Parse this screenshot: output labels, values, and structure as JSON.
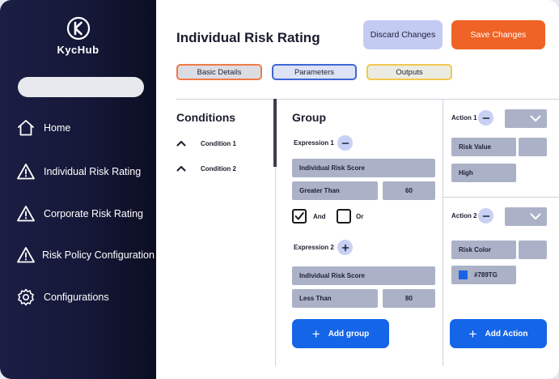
{
  "brand": {
    "logo_text": "KycHub"
  },
  "sidebar": {
    "search_value": "",
    "items": [
      {
        "label": "Home",
        "icon": "home-icon"
      },
      {
        "label": "Individual Risk Rating",
        "icon": "warning-icon"
      },
      {
        "label": "Corporate Risk Rating",
        "icon": "warning-icon"
      },
      {
        "label": "Risk Policy Configuration",
        "icon": "warning-icon"
      },
      {
        "label": "Configurations",
        "icon": "gear-icon"
      }
    ]
  },
  "header": {
    "title": "Individual Risk Rating",
    "discard_label": "Discard Changes",
    "save_label": "Save Changes"
  },
  "tabs": [
    {
      "label": "Basic Details",
      "border_color": "#f07a48"
    },
    {
      "label": "Parameters",
      "border_color": "#3e66d6"
    },
    {
      "label": "Outputs",
      "border_color": "#f0c94c"
    }
  ],
  "conditions": {
    "title": "Conditions",
    "items": [
      {
        "label": "Condition 1"
      },
      {
        "label": "Condition 2"
      }
    ]
  },
  "group": {
    "title": "Group",
    "expression1": {
      "label": "Expression 1",
      "parameter": "Individual Risk Score",
      "operator": "Greater Than",
      "value": "60"
    },
    "logic": {
      "and_label": "And",
      "and_checked": true,
      "or_label": "Or",
      "or_checked": false
    },
    "expression2": {
      "label": "Expression 2",
      "parameter": "Individual Risk Score",
      "operator": "Less Than",
      "value": "80"
    },
    "add_group_label": "Add group"
  },
  "actions": {
    "action1": {
      "label": "Action 1",
      "field": "Risk Value",
      "value": "High"
    },
    "action2": {
      "label": "Action 2",
      "field": "Risk Color",
      "value": "#789TG",
      "swatch_color": "#1a64e4"
    },
    "add_action_label": "Add Action"
  },
  "colors": {
    "sidebar_bg": "#151838",
    "accent_blue": "#1565e8",
    "save_orange": "#f06326",
    "discard_bg": "#c4cbf3",
    "field_bg": "#abb2c8"
  }
}
